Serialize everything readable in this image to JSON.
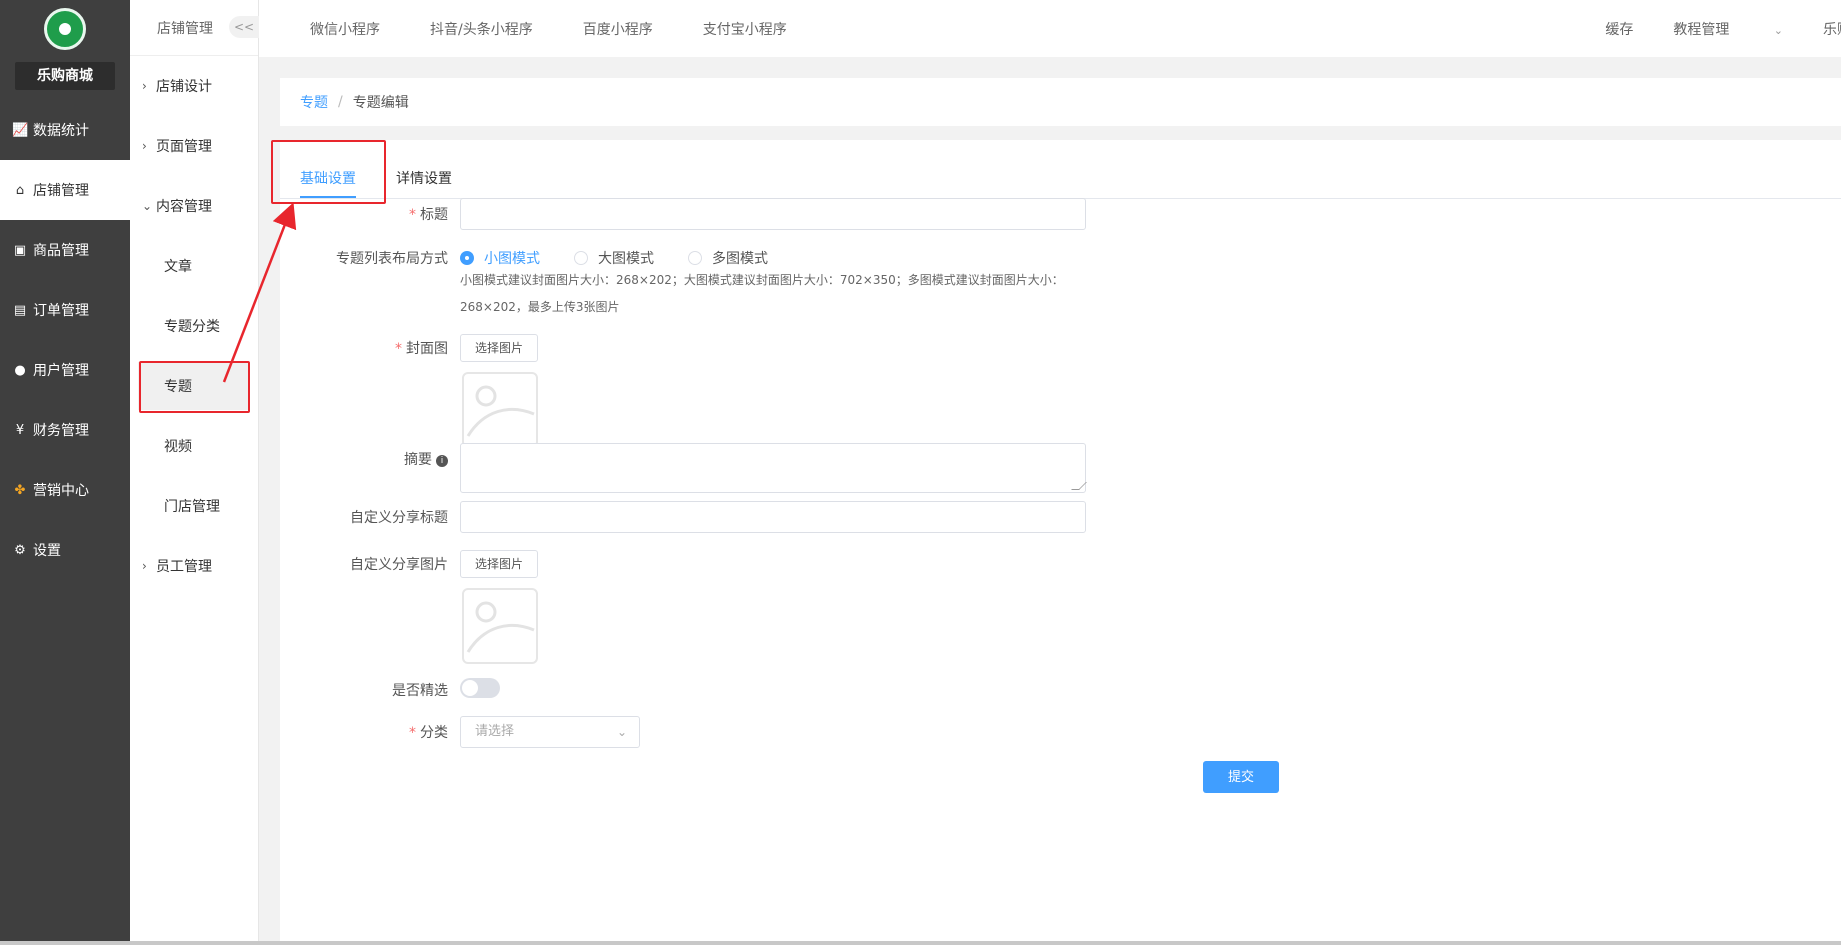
{
  "sidebar": {
    "shop_name": "乐购商城",
    "items": [
      {
        "label": "数据统计",
        "icon": "chart-icon"
      },
      {
        "label": "店铺管理",
        "icon": "shop-icon"
      },
      {
        "label": "商品管理",
        "icon": "goods-icon"
      },
      {
        "label": "订单管理",
        "icon": "order-icon"
      },
      {
        "label": "用户管理",
        "icon": "user-icon"
      },
      {
        "label": "财务管理",
        "icon": "finance-icon"
      },
      {
        "label": "营销中心",
        "icon": "marketing-icon"
      },
      {
        "label": "设置",
        "icon": "settings-icon"
      }
    ]
  },
  "subnav": {
    "title": "店铺管理",
    "collapse": "<<",
    "groups": [
      {
        "label": "店铺设计"
      },
      {
        "label": "页面管理"
      },
      {
        "label": "内容管理"
      }
    ],
    "children": [
      "文章",
      "专题分类",
      "专题",
      "视频",
      "门店管理"
    ],
    "last_group": "员工管理"
  },
  "topbar": {
    "tabs": [
      "微信小程序",
      "抖音/头条小程序",
      "百度小程序",
      "支付宝小程序"
    ],
    "cache": "缓存",
    "tutorial": "教程管理",
    "user": "乐购"
  },
  "breadcrumb": {
    "parent": "专题",
    "sep": "/",
    "current": "专题编辑"
  },
  "tabs": {
    "basic": "基础设置",
    "detail": "详情设置"
  },
  "form": {
    "title_label": "标题",
    "layout_label": "专题列表布局方式",
    "layout_options": [
      "小图模式",
      "大图模式",
      "多图模式"
    ],
    "layout_hint_1": "小图模式建议封面图片大小：268×202；大图模式建议封面图片大小：702×350；多图模式建议封面图片大小：",
    "layout_hint_2": "268×202，最多上传3张图片",
    "cover_label": "封面图",
    "choose_image": "选择图片",
    "summary_label": "摘要",
    "share_title_label": "自定义分享标题",
    "share_image_label": "自定义分享图片",
    "featured_label": "是否精选",
    "category_label": "分类",
    "category_placeholder": "请选择",
    "submit": "提交",
    "required_mark": "*",
    "info_mark": "i"
  },
  "colors": {
    "accent": "#409eff",
    "sidebar_bg": "#3f3f3f",
    "annotation": "#e8262d"
  }
}
